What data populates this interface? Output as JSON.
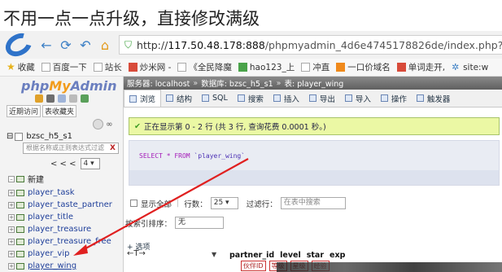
{
  "caption": "不用一点一点升级，直接修改满级",
  "browser": {
    "url_prefix": "http://",
    "url_host": "117.50.48.178:888",
    "url_path": "/phpmyadmin_4d6e4745178826de/index.php?db=bzs"
  },
  "bookmarks": [
    "收藏",
    "百度一下",
    "站长",
    "炒米网 -",
    "《全民降魔",
    "hao123_上",
    "冲直",
    "一口价域名",
    "单词走开,",
    "site:w"
  ],
  "pma": {
    "logo_php": "php",
    "logo_my": "My",
    "logo_admin": "Admin",
    "tabs_small": [
      "近期访问",
      "表收藏夹"
    ],
    "db_name": "bzsc_h5_s1",
    "filter_placeholder": "根据名称或正则表达式过滤",
    "filter_clear": "X",
    "pager_prev": "< < <",
    "pager_value": "4",
    "new_label": "新建",
    "tables": [
      "player_task",
      "player_taste_partner",
      "player_title",
      "player_treasure",
      "player_treasure_free",
      "player_vip",
      "player_wing"
    ],
    "breadcrumb": [
      "服务器: localhost",
      "数据库: bzsc_h5_s1",
      "表: player_wing"
    ],
    "tabs": [
      "浏览",
      "结构",
      "SQL",
      "搜索",
      "插入",
      "导出",
      "导入",
      "操作",
      "触发器"
    ],
    "success_msg": "正在显示第 0 - 2 行 (共 3 行, 查询花费 0.0001 秒。)",
    "sql_keyword": "SELECT * FROM",
    "sql_table": "`player_wing`",
    "show_all": "显示全部",
    "rows_label": "行数：",
    "rows_value": "25",
    "filter_rows_label": "过滤行：",
    "filter_rows_placeholder": "在表中搜索",
    "sort_label": "按索引排序：",
    "sort_value": "无",
    "options_label": "+ 选项",
    "columns": [
      "partner_id",
      "level",
      "star",
      "exp"
    ],
    "column_sub": [
      "伙伴ID",
      "等级",
      "星级",
      "经验"
    ]
  }
}
